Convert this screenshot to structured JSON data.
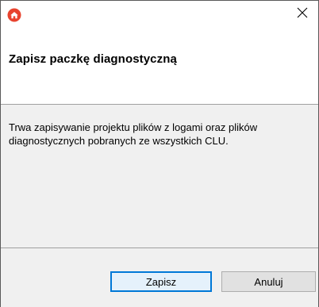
{
  "window": {
    "icon": "home-logo-icon",
    "close_icon": "close-icon",
    "close_symbol": "✕"
  },
  "header": {
    "title": "Zapisz paczkę diagnostyczną"
  },
  "content": {
    "message": "Trwa zapisywanie projektu plików z logami oraz plików diagnostycznych pobranych ze wszystkich CLU."
  },
  "footer": {
    "save_label": "Zapisz",
    "cancel_label": "Anuluj"
  },
  "colors": {
    "accent": "#0078d7",
    "logo_red": "#e8432e",
    "header_bg": "#ffffff",
    "body_bg": "#f0f0f0"
  }
}
